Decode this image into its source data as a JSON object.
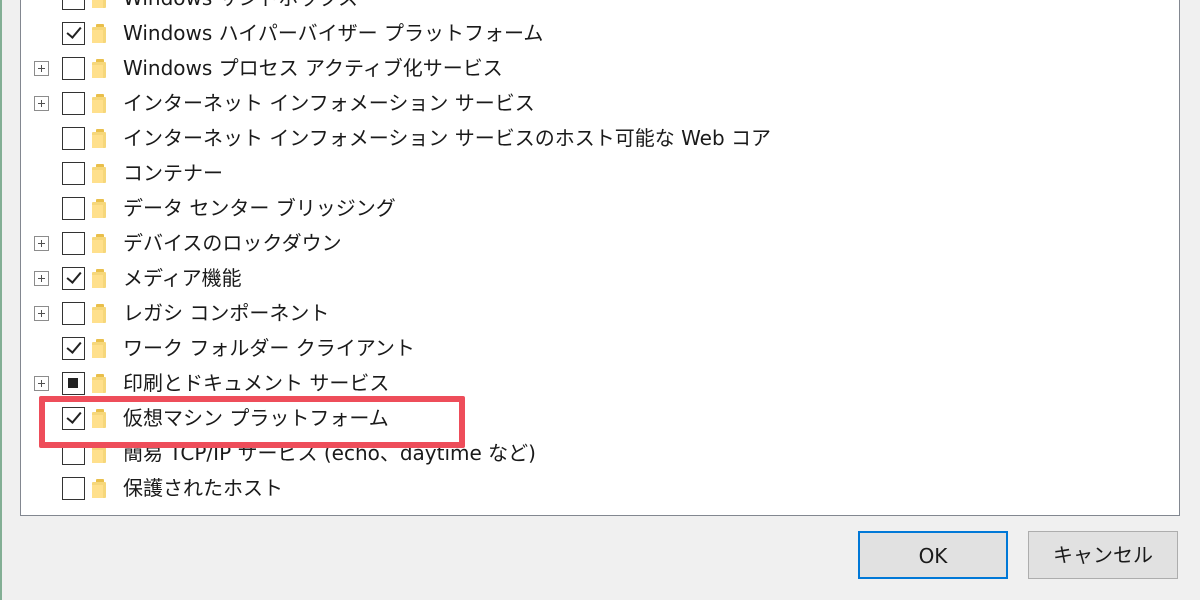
{
  "features": [
    {
      "label": "Windows サンドボックス",
      "checked": "unchecked",
      "expandable": false
    },
    {
      "label": "Windows ハイパーバイザー プラットフォーム",
      "checked": "checked",
      "expandable": false
    },
    {
      "label": "Windows プロセス アクティブ化サービス",
      "checked": "unchecked",
      "expandable": true
    },
    {
      "label": "インターネット インフォメーション サービス",
      "checked": "unchecked",
      "expandable": true
    },
    {
      "label": "インターネット インフォメーション サービスのホスト可能な Web コア",
      "checked": "unchecked",
      "expandable": false
    },
    {
      "label": "コンテナー",
      "checked": "unchecked",
      "expandable": false
    },
    {
      "label": "データ センター ブリッジング",
      "checked": "unchecked",
      "expandable": false
    },
    {
      "label": "デバイスのロックダウン",
      "checked": "unchecked",
      "expandable": true
    },
    {
      "label": "メディア機能",
      "checked": "checked",
      "expandable": true
    },
    {
      "label": "レガシ コンポーネント",
      "checked": "unchecked",
      "expandable": true
    },
    {
      "label": "ワーク フォルダー クライアント",
      "checked": "checked",
      "expandable": false
    },
    {
      "label": "印刷とドキュメント サービス",
      "checked": "partial",
      "expandable": true
    },
    {
      "label": "仮想マシン プラットフォーム",
      "checked": "checked",
      "expandable": false
    },
    {
      "label": "簡易 TCP/IP サービス (echo、daytime など)",
      "checked": "unchecked",
      "expandable": false
    },
    {
      "label": "保護されたホスト",
      "checked": "unchecked",
      "expandable": false
    }
  ],
  "buttons": {
    "ok_label": "OK",
    "cancel_label": "キャンセル"
  },
  "highlight_color": "#ee4d5a",
  "icons": {
    "expander": "plus-box-icon",
    "folder": "folder-icon"
  }
}
